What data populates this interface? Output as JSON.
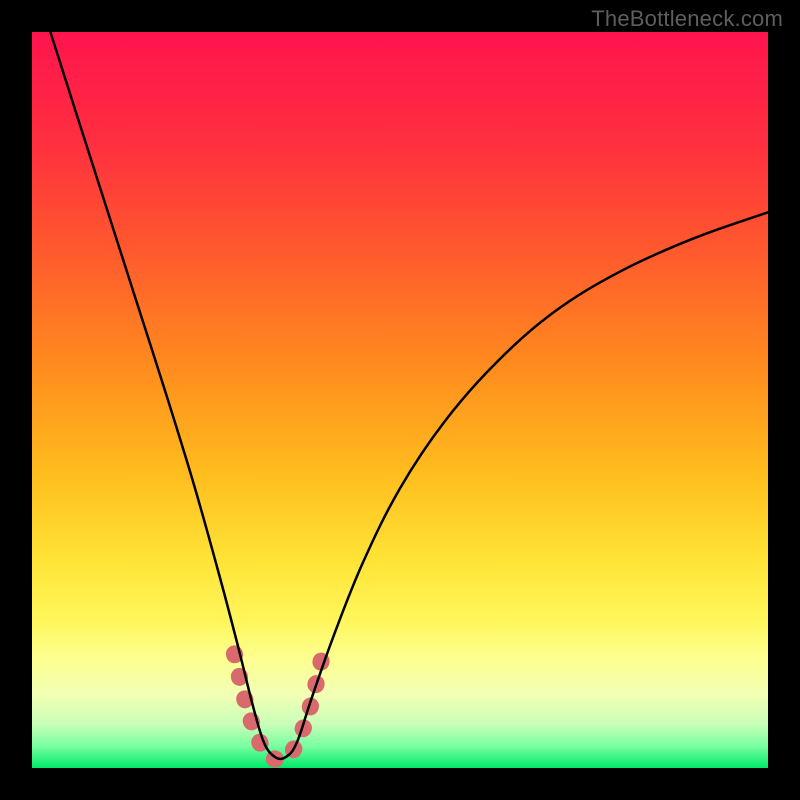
{
  "watermark": "TheBottleneck.com",
  "colors": {
    "background": "#000000",
    "curve": "#000000",
    "highlight": "#d86a6e",
    "watermark": "#5e5e5e"
  },
  "chart_data": {
    "type": "line",
    "title": "",
    "xlabel": "",
    "ylabel": "",
    "xlim": [
      0,
      1
    ],
    "ylim": [
      0,
      1
    ],
    "gradient_stops": [
      {
        "offset": 0.0,
        "color": "#ff144e"
      },
      {
        "offset": 0.15,
        "color": "#ff2f3f"
      },
      {
        "offset": 0.3,
        "color": "#ff5a2d"
      },
      {
        "offset": 0.45,
        "color": "#ff8a1e"
      },
      {
        "offset": 0.6,
        "color": "#ffbd1e"
      },
      {
        "offset": 0.72,
        "color": "#ffe437"
      },
      {
        "offset": 0.8,
        "color": "#fff65c"
      },
      {
        "offset": 0.85,
        "color": "#fdff8e"
      },
      {
        "offset": 0.9,
        "color": "#f2ffb4"
      },
      {
        "offset": 0.94,
        "color": "#c9ffb8"
      },
      {
        "offset": 0.97,
        "color": "#7affa0"
      },
      {
        "offset": 1.0,
        "color": "#00e86b"
      }
    ],
    "series": [
      {
        "name": "bottleneck-curve",
        "x": [
          0.025,
          0.06,
          0.1,
          0.14,
          0.18,
          0.22,
          0.255,
          0.28,
          0.3,
          0.315,
          0.33,
          0.345,
          0.36,
          0.38,
          0.41,
          0.45,
          0.5,
          0.56,
          0.63,
          0.71,
          0.8,
          0.9,
          1.0
        ],
        "y": [
          1.0,
          0.89,
          0.765,
          0.64,
          0.515,
          0.385,
          0.26,
          0.165,
          0.085,
          0.035,
          0.015,
          0.015,
          0.035,
          0.095,
          0.18,
          0.28,
          0.38,
          0.47,
          0.55,
          0.62,
          0.675,
          0.72,
          0.755
        ]
      }
    ],
    "highlight_segment": {
      "note": "thick pink overlay near minimum",
      "x": [
        0.275,
        0.29,
        0.305,
        0.32,
        0.335,
        0.35,
        0.365,
        0.38,
        0.395
      ],
      "y": [
        0.155,
        0.09,
        0.045,
        0.018,
        0.012,
        0.018,
        0.045,
        0.09,
        0.155
      ]
    }
  }
}
